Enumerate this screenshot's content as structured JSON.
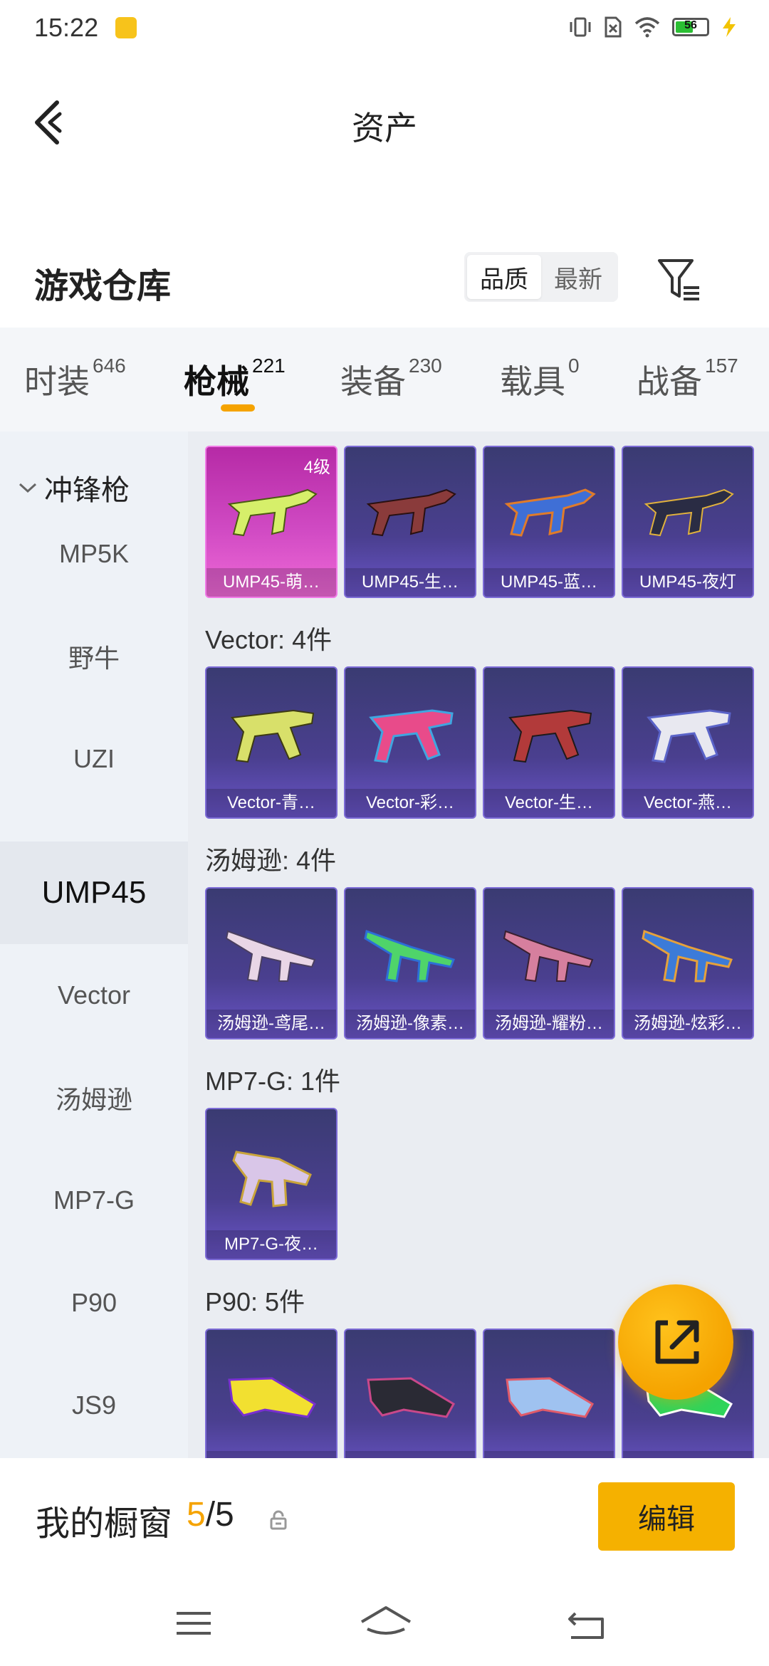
{
  "status_bar": {
    "time": "15:22",
    "battery_level": "56",
    "icons": [
      "app-notification-icon",
      "vibrate-icon",
      "sim-missing-icon",
      "wifi-icon",
      "battery-icon",
      "charging-icon"
    ]
  },
  "header": {
    "title": "资产"
  },
  "warehouse": {
    "title": "游戏仓库",
    "sort_options": [
      "品质",
      "最新"
    ],
    "sort_selected": "品质"
  },
  "tabs": [
    {
      "label": "时装",
      "count": "646"
    },
    {
      "label": "枪械",
      "count": "221"
    },
    {
      "label": "装备",
      "count": "230"
    },
    {
      "label": "载具",
      "count": "0"
    },
    {
      "label": "战备",
      "count": "157"
    }
  ],
  "active_tab": "枪械",
  "sidebar": {
    "group": "冲锋枪",
    "items": [
      "MP5K",
      "野牛",
      "UZI",
      "UMP45",
      "Vector",
      "汤姆逊",
      "MP7-G",
      "P90",
      "JS9"
    ],
    "active": "UMP45"
  },
  "sections": [
    {
      "title": "",
      "items": [
        {
          "label": "UMP45-萌…",
          "level": "4级"
        },
        {
          "label": "UMP45-生…"
        },
        {
          "label": "UMP45-蓝…"
        },
        {
          "label": "UMP45-夜灯"
        }
      ]
    },
    {
      "title": "Vector: 4件",
      "items": [
        {
          "label": "Vector-青…"
        },
        {
          "label": "Vector-彩…"
        },
        {
          "label": "Vector-生…"
        },
        {
          "label": "Vector-燕…"
        }
      ]
    },
    {
      "title": "汤姆逊: 4件",
      "items": [
        {
          "label": "汤姆逊-鸢尾…"
        },
        {
          "label": "汤姆逊-像素…"
        },
        {
          "label": "汤姆逊-耀粉…"
        },
        {
          "label": "汤姆逊-炫彩…"
        }
      ]
    },
    {
      "title": "MP7-G: 1件",
      "items": [
        {
          "label": "MP7-G-夜…"
        }
      ]
    },
    {
      "title": "P90: 5件",
      "items": [
        {
          "label": ""
        },
        {
          "label": ""
        },
        {
          "label": ""
        },
        {
          "label": ""
        }
      ]
    }
  ],
  "showcase": {
    "title": "我的橱窗",
    "current": "5",
    "total": "/5",
    "edit_label": "编辑"
  },
  "colors": {
    "accent": "#f5a300",
    "card_purple": "#4a3f8f",
    "card_pink": "#d04ac3"
  }
}
